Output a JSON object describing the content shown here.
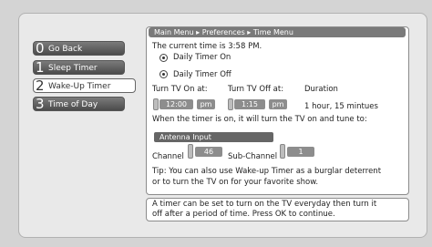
{
  "menu": {
    "items": [
      {
        "num": "0",
        "label": "Go Back"
      },
      {
        "num": "1",
        "label": "Sleep Timer"
      },
      {
        "num": "2",
        "label": "Wake-Up Timer"
      },
      {
        "num": "3",
        "label": "Time of Day"
      }
    ]
  },
  "breadcrumb": "Main Menu ▸ Preferences ▸ Time Menu",
  "current_time": "The current time is 3:58 PM.",
  "options": {
    "on": "Daily Timer On",
    "off": "Daily Timer Off"
  },
  "labels": {
    "on_at": "Turn TV On at:",
    "off_at": "Turn TV Off at:",
    "duration": "Duration"
  },
  "on_time": {
    "value": "12:00",
    "ampm": "pm"
  },
  "off_time": {
    "value": "1:15",
    "ampm": "pm"
  },
  "duration_value": "1 hour, 15 mintues",
  "tune_text": "When the timer is on, it will turn the TV on and tune to:",
  "input": "Antenna Input",
  "channel": {
    "label": "Channel",
    "value": "46"
  },
  "subchannel": {
    "label": "Sub-Channel",
    "value": "1"
  },
  "tip": {
    "line1": "Tip: You can also use Wake-up Timer as a burglar deterrent",
    "line2": "or to turn the TV on for your favorite show."
  },
  "footer": {
    "line1": "A timer can be set to turn on the TV everyday then turn it",
    "line2": "off after a period of time. Press OK to continue."
  }
}
